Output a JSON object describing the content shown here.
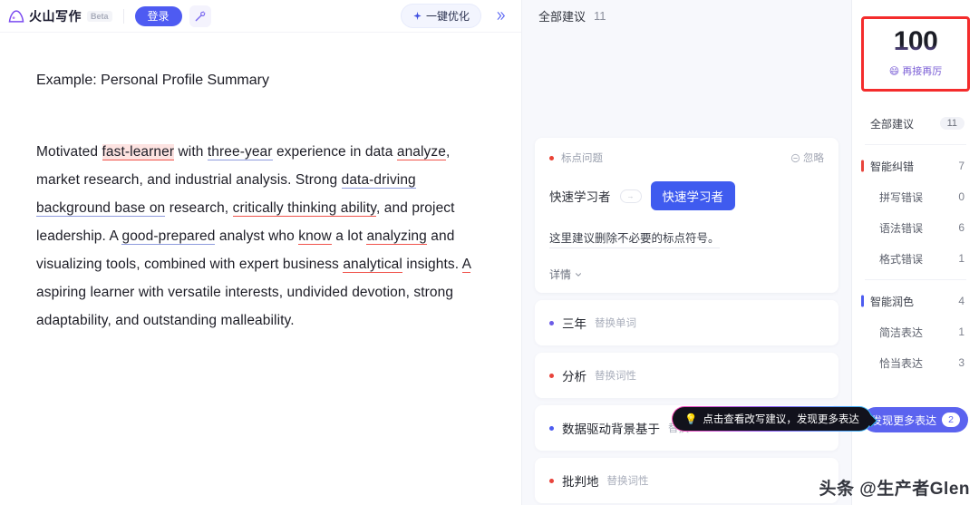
{
  "header": {
    "brand_name": "火山写作",
    "beta_label": "Beta",
    "login_label": "登录",
    "magic_icon": "magic-wand-icon",
    "optimize_label": "一键优化",
    "sparkle_icon": "sparkle-icon",
    "expand_icon": "double-chevron-right-icon"
  },
  "document": {
    "title": "Example: Personal Profile Summary",
    "paragraph_segments": [
      {
        "text": "Motivated ",
        "style": "plain"
      },
      {
        "text": "fast-learner",
        "style": "highlight-red"
      },
      {
        "text": " with ",
        "style": "plain"
      },
      {
        "text": "three-year",
        "style": "underline-blue"
      },
      {
        "text": " experience in data ",
        "style": "plain"
      },
      {
        "text": "analyze",
        "style": "underline-red"
      },
      {
        "text": ", market research, and industrial analysis. Strong ",
        "style": "plain"
      },
      {
        "text": "data-driving background base on",
        "style": "underline-blue"
      },
      {
        "text": " research, ",
        "style": "plain"
      },
      {
        "text": "critically thinking ability",
        "style": "underline-red"
      },
      {
        "text": ", and project leadership. A ",
        "style": "plain"
      },
      {
        "text": "good-prepared",
        "style": "underline-blue"
      },
      {
        "text": " analyst who ",
        "style": "plain"
      },
      {
        "text": "know",
        "style": "underline-red"
      },
      {
        "text": " a lot ",
        "style": "plain"
      },
      {
        "text": "analyzing",
        "style": "underline-red"
      },
      {
        "text": " and visualizing tools, combined with expert business ",
        "style": "plain"
      },
      {
        "text": "analytical",
        "style": "underline-red"
      },
      {
        "text": " insights. ",
        "style": "plain"
      },
      {
        "text": "A",
        "style": "underline-red"
      },
      {
        "text": " aspiring learner with versatile interests, undivided devotion, strong adaptability, and outstanding malleability.",
        "style": "plain"
      }
    ]
  },
  "suggestions": {
    "header_label": "全部建议",
    "header_count": "11",
    "card": {
      "tag": "标点问题",
      "dot_color": "#ea4335",
      "ignore_label": "忽略",
      "ignore_icon": "minus-circle-icon",
      "original_word": "快速学习者",
      "arrow_glyph": "→",
      "replacement_word": "快速学习者",
      "description": "这里建议删除不必要的标点符号。",
      "more_label": "详情",
      "more_icon": "chevron-down-icon"
    },
    "rows": [
      {
        "word": "三年",
        "action": "替换单词",
        "dot_color": "#6c5ce7"
      },
      {
        "word": "分析",
        "action": "替换词性",
        "dot_color": "#e8443c"
      },
      {
        "word": "数据驱动背景基于",
        "action": "替换",
        "dot_color": "#4d5cf0"
      },
      {
        "word": "批判地",
        "action": "替换词性",
        "dot_color": "#e8443c"
      }
    ]
  },
  "tooltip": {
    "icon": "lightbulb-icon",
    "text": "点击查看改写建议，发现更多表达"
  },
  "sidebar": {
    "score": "100",
    "score_emoji": "😄",
    "score_caption": "再接再厉",
    "items": [
      {
        "label": "全部建议",
        "count": "11",
        "level": "all",
        "bar": "none"
      },
      {
        "label": "智能纠错",
        "count": "7",
        "level": "top",
        "bar": "red"
      },
      {
        "label": "拼写错误",
        "count": "0",
        "level": "sub",
        "bar": "none"
      },
      {
        "label": "语法错误",
        "count": "6",
        "level": "sub",
        "bar": "none"
      },
      {
        "label": "格式错误",
        "count": "1",
        "level": "sub",
        "bar": "none"
      },
      {
        "label": "智能润色",
        "count": "4",
        "level": "top",
        "bar": "blue"
      },
      {
        "label": "简洁表达",
        "count": "1",
        "level": "sub",
        "bar": "none"
      },
      {
        "label": "恰当表达",
        "count": "3",
        "level": "sub",
        "bar": "none"
      }
    ],
    "discover_label": "发现更多表达",
    "discover_count": "2"
  },
  "watermark": {
    "text": "头条 @生产者Glen"
  },
  "colors": {
    "accent_blue": "#4e5bf2",
    "error_red": "#e8443c",
    "highlight_red": "#fde3e1",
    "panel_bg": "#f7f8fc"
  }
}
